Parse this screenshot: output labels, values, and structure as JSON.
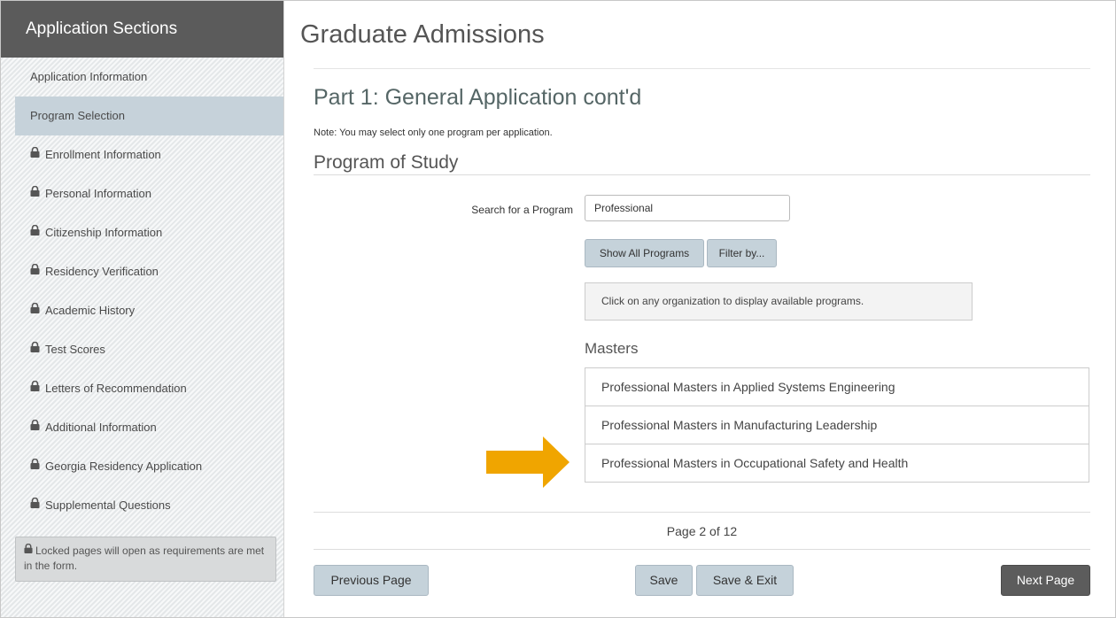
{
  "sidebar": {
    "header": "Application Sections",
    "items": [
      {
        "label": "Application Information",
        "locked": false
      },
      {
        "label": "Program Selection",
        "locked": false,
        "active": true
      },
      {
        "label": "Enrollment Information",
        "locked": true
      },
      {
        "label": "Personal Information",
        "locked": true
      },
      {
        "label": "Citizenship Information",
        "locked": true
      },
      {
        "label": "Residency Verification",
        "locked": true
      },
      {
        "label": "Academic History",
        "locked": true
      },
      {
        "label": "Test Scores",
        "locked": true
      },
      {
        "label": "Letters of Recommendation",
        "locked": true
      },
      {
        "label": "Additional Information",
        "locked": true
      },
      {
        "label": "Georgia Residency Application",
        "locked": true
      },
      {
        "label": "Supplemental Questions",
        "locked": true
      }
    ],
    "note": "Locked pages will open as requirements are met in the form."
  },
  "main": {
    "title": "Graduate Admissions",
    "part_title": "Part 1: General Application cont'd",
    "note": "Note: You may select only one program per application.",
    "section_title": "Program of Study",
    "search": {
      "label": "Search for a Program",
      "value": "Professional"
    },
    "buttons": {
      "show_all": "Show All Programs",
      "filter": "Filter by..."
    },
    "info_text": "Click on any organization to display available programs.",
    "group_title": "Masters",
    "programs": [
      "Professional Masters in Applied Systems Engineering",
      "Professional Masters in Manufacturing Leadership",
      "Professional Masters in Occupational Safety and Health"
    ],
    "pager": "Page 2 of 12",
    "nav": {
      "previous": "Previous Page",
      "save": "Save",
      "save_exit": "Save & Exit",
      "next": "Next Page"
    }
  },
  "colors": {
    "arrow": "#f0a500",
    "header": "#5b5b5b",
    "active": "#c6d2da",
    "button": "#c5d2da",
    "next": "#5c5c5c"
  }
}
